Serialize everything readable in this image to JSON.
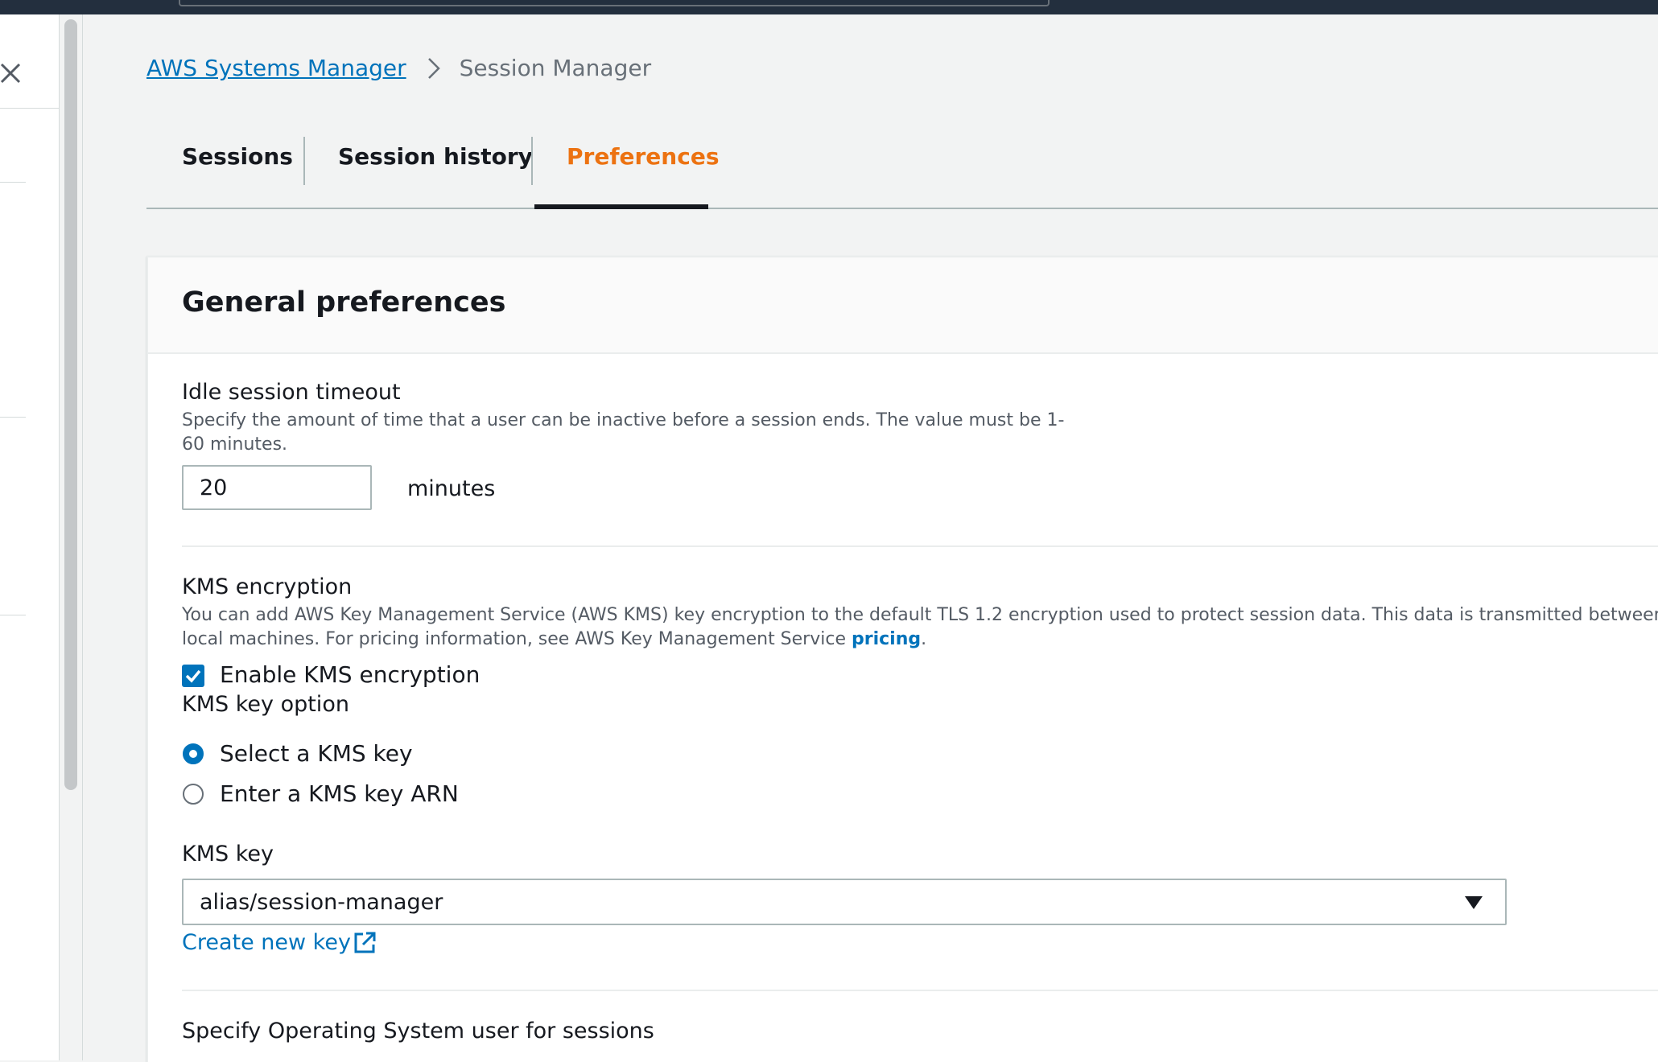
{
  "breadcrumb": {
    "parent": "AWS Systems Manager",
    "current": "Session Manager"
  },
  "tabs": [
    {
      "label": "Sessions",
      "active": false
    },
    {
      "label": "Session history",
      "active": false
    },
    {
      "label": "Preferences",
      "active": true
    }
  ],
  "panel": {
    "title": "General preferences",
    "idle": {
      "label": "Idle session timeout",
      "description_line1": "Specify the amount of time that a user can be inactive before a session ends. The value must be 1-",
      "description_line2": "60 minutes.",
      "value": "20",
      "unit": "minutes"
    },
    "kms": {
      "label": "KMS encryption",
      "description_line1": "You can add AWS Key Management Service (AWS KMS) key encryption to the default TLS 1.2 encryption used to protect session data. This data is transmitted between yo",
      "description_line2_prefix": "local machines. For pricing information, see AWS Key Management Service ",
      "pricing_link": "pricing",
      "description_line2_suffix": ".",
      "enable_label": "Enable KMS encryption",
      "enable_checked": true,
      "key_option_label": "KMS key option",
      "options": [
        {
          "label": "Select a KMS key",
          "selected": true
        },
        {
          "label": "Enter a KMS key ARN",
          "selected": false
        }
      ],
      "key_label": "KMS key",
      "key_value": "alias/session-manager",
      "create_link": "Create new key"
    },
    "os_user": {
      "label": "Specify Operating System user for sessions"
    }
  },
  "colors": {
    "link": "#0073bb",
    "active_tab": "#ec7211",
    "topbar": "#232f3e"
  },
  "icons": {
    "close": "close-icon",
    "breadcrumb_separator": "chevron-right-icon",
    "dropdown": "caret-down-icon",
    "external": "external-link-icon",
    "checkbox": "check-icon"
  }
}
